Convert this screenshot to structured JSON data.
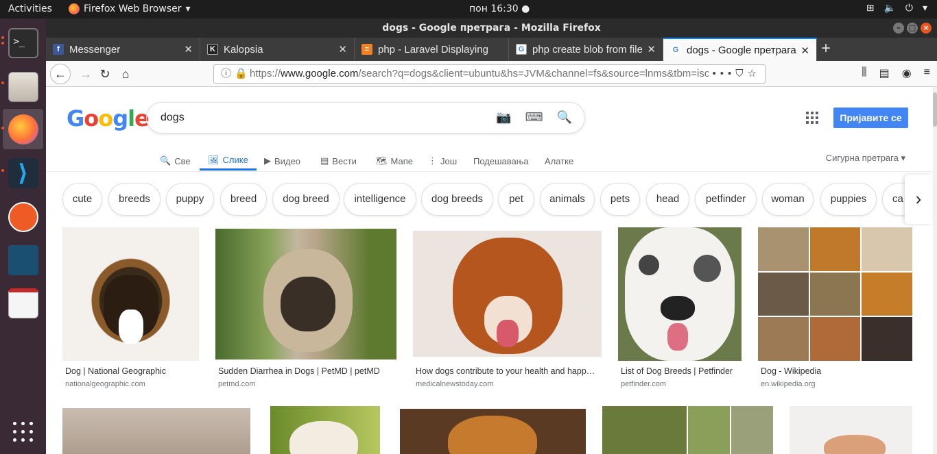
{
  "topbar": {
    "activities": "Activities",
    "app_name": "Firefox Web Browser",
    "clock": "пон 16:30",
    "status_icons": [
      "network-icon",
      "volume-icon",
      "power-icon"
    ]
  },
  "dock": {
    "apps": [
      "terminal",
      "files",
      "firefox",
      "vscode",
      "postman",
      "mysql-workbench",
      "text-editor",
      "show-applications"
    ]
  },
  "window": {
    "title": "dogs - Google претрага - Mozilla Firefox"
  },
  "tabs": [
    {
      "label": "Messenger",
      "favicon": "f",
      "color": "#3b5998"
    },
    {
      "label": "Kalopsia",
      "favicon": "K",
      "color": "#222"
    },
    {
      "label": "php - Laravel Displaying i",
      "favicon": "s",
      "color": "#f48024"
    },
    {
      "label": "php create blob from file",
      "favicon": "G",
      "color": "#4285f4"
    },
    {
      "label": "dogs - Google претрага",
      "favicon": "G",
      "color": "#4285f4"
    }
  ],
  "navbar": {
    "url_prefix": "https://",
    "url_host": "www.google.com",
    "url_rest": "/search?q=dogs&client=ubuntu&hs=JVM&channel=fs&source=lnms&tbm=isch"
  },
  "google": {
    "logo_letters": [
      {
        "ch": "G",
        "color": "#4285f4"
      },
      {
        "ch": "o",
        "color": "#ea4335"
      },
      {
        "ch": "o",
        "color": "#fbbc05"
      },
      {
        "ch": "g",
        "color": "#4285f4"
      },
      {
        "ch": "l",
        "color": "#34a853"
      },
      {
        "ch": "e",
        "color": "#ea4335"
      }
    ],
    "query": "dogs",
    "signin": "Пријавите се",
    "filters": [
      "Све",
      "Слике",
      "Видео",
      "Вести",
      "Мапе",
      "Још"
    ],
    "settings": "Подешавања",
    "tools": "Алатке",
    "safe_search": "Сигурна претрага ▾",
    "chips": [
      "cute",
      "breeds",
      "puppy",
      "breed",
      "dog breed",
      "intelligence",
      "dog breeds",
      "pet",
      "animals",
      "pets",
      "head",
      "petfinder",
      "woman",
      "puppies",
      "ca"
    ],
    "results": [
      {
        "title": "Dog | National Geographic",
        "site": "nationalgeographic.com"
      },
      {
        "title": "Sudden Diarrhea in Dogs | PetMD | petMD",
        "site": "petmd.com"
      },
      {
        "title": "How dogs contribute to your health and happ…",
        "site": "medicalnewstoday.com"
      },
      {
        "title": "List of Dog Breeds | Petfinder",
        "site": "petfinder.com"
      },
      {
        "title": "Dog - Wikipedia",
        "site": "en.wikipedia.org"
      }
    ]
  },
  "colors": {
    "accent": "#1a73e8",
    "signin_bg": "#4285f4",
    "dock_bg": "#3a2a36",
    "tab_strip": "#3c3c3c"
  }
}
